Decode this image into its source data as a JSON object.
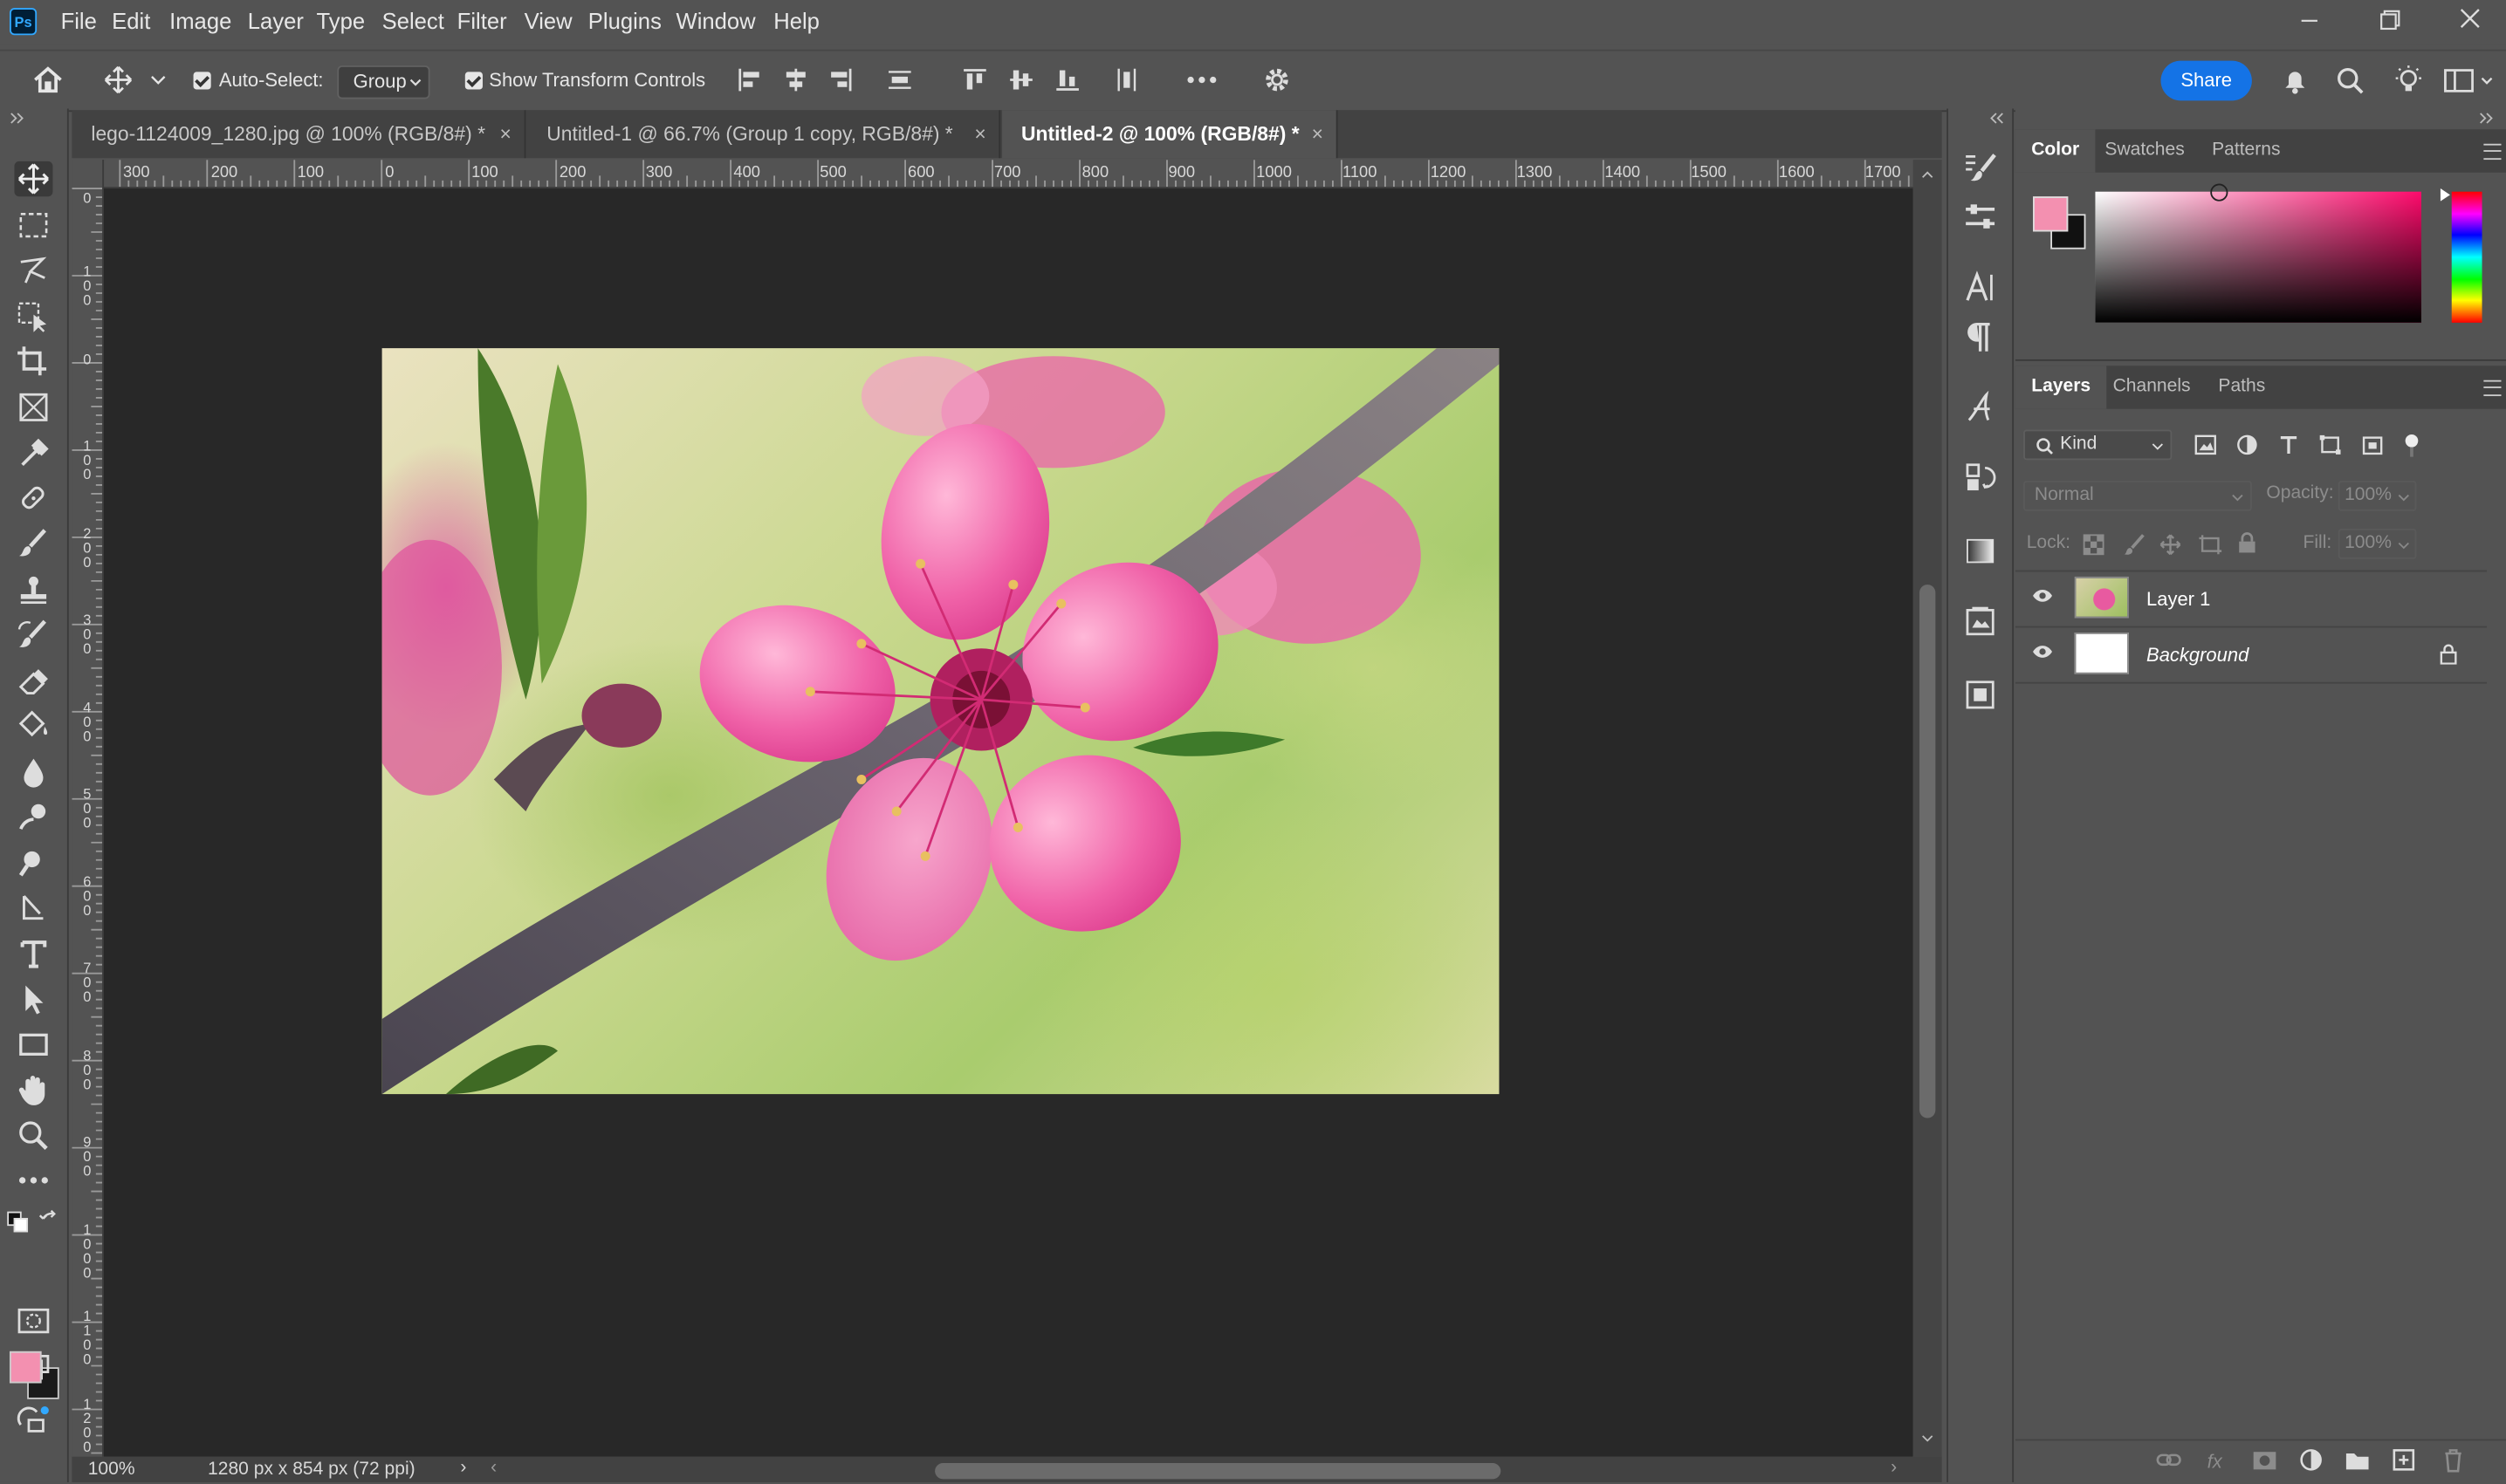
{
  "app": {
    "logo_text": "Ps"
  },
  "menu": [
    "File",
    "Edit",
    "Image",
    "Layer",
    "Type",
    "Select",
    "Filter",
    "View",
    "Plugins",
    "Window",
    "Help"
  ],
  "options_bar": {
    "auto_select_label": "Auto-Select:",
    "auto_select_checked": true,
    "group_value": "Group",
    "show_transform_label": "Show Transform Controls",
    "show_transform_checked": true,
    "share_label": "Share"
  },
  "tabs": [
    {
      "label": "lego-1124009_1280.jpg @ 100% (RGB/8#) *",
      "close": "×",
      "active": false
    },
    {
      "label": "Untitled-1 @ 66.7% (Group 1 copy, RGB/8#) *",
      "close": "×",
      "active": false
    },
    {
      "label": "Untitled-2 @ 100% (RGB/8#) *",
      "close": "×",
      "active": true
    }
  ],
  "ruler": {
    "horizontal": [
      "300",
      "200",
      "100",
      "0",
      "100",
      "200",
      "300",
      "400",
      "500",
      "600",
      "700",
      "800",
      "900",
      "1000",
      "1100",
      "1200",
      "1300",
      "1400",
      "1500",
      "1600",
      "1700"
    ],
    "vertical": [
      "0",
      "100",
      "0",
      "100",
      "200",
      "300",
      "400",
      "500",
      "600",
      "700",
      "800",
      "900",
      "1000",
      "1100",
      "1200"
    ]
  },
  "status": {
    "zoom": "100%",
    "doc_info": "1280 px x 854 px (72 ppi)",
    "arrow": "›",
    "left_arrow": "‹",
    "right_arrow": "›"
  },
  "colors": {
    "foreground": "#f390b0",
    "background": "#111111",
    "accent": "#1473e6"
  },
  "color_panel": {
    "tabs": [
      "Color",
      "Swatches",
      "Patterns"
    ],
    "active_tab": "Color"
  },
  "layers_panel": {
    "tabs": [
      "Layers",
      "Channels",
      "Paths"
    ],
    "active_tab": "Layers",
    "filter_kind": "Kind",
    "blend_mode": "Normal",
    "opacity_label": "Opacity:",
    "opacity_value": "100%",
    "lock_label": "Lock:",
    "fill_label": "Fill:",
    "fill_value": "100%",
    "layers": [
      {
        "name": "Layer 1",
        "visible": true,
        "locked": false,
        "selected": false
      },
      {
        "name": "Background",
        "visible": true,
        "locked": true,
        "selected": false
      }
    ],
    "footer_fx": "fx"
  }
}
